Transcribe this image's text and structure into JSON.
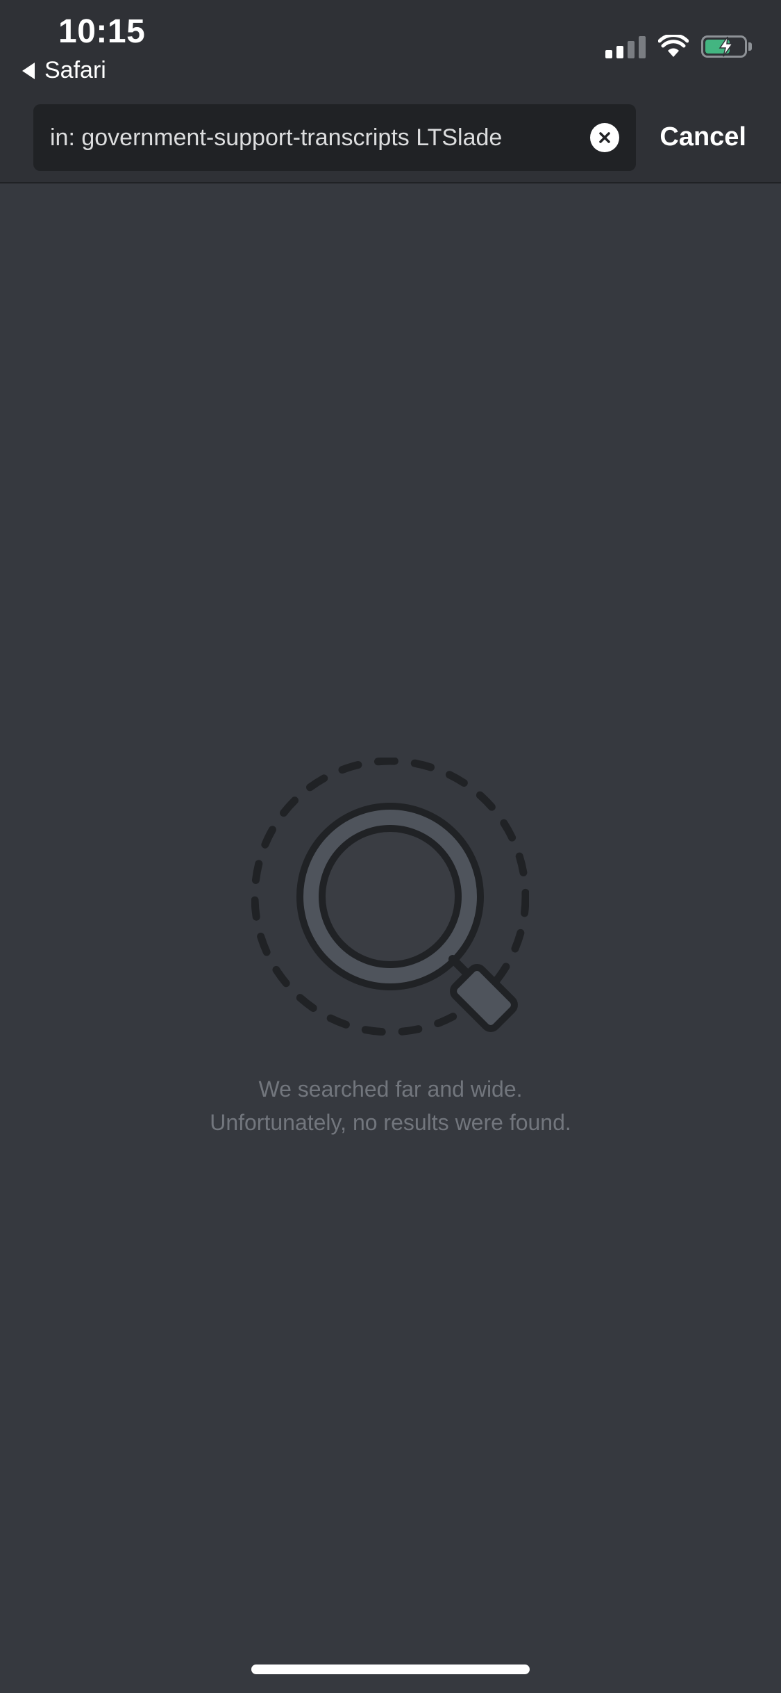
{
  "status_bar": {
    "time": "10:15",
    "back_app": "Safari",
    "signal_bars": 4,
    "signal_bars_active": 2,
    "battery_level": 0.64,
    "battery_state": "charging",
    "battery_color": "#43b581"
  },
  "search": {
    "query": "in: government-support-transcripts LTSlade",
    "clear_icon": "close-circle-icon",
    "cancel_label": "Cancel"
  },
  "empty_state": {
    "icon": "magnifying-glass-icon",
    "line1": "We searched far and wide.",
    "line2": "Unfortunately, no results were found."
  },
  "colors": {
    "background": "#36393f",
    "header": "#2f3136",
    "input": "#202225",
    "muted_text": "#72767d"
  }
}
